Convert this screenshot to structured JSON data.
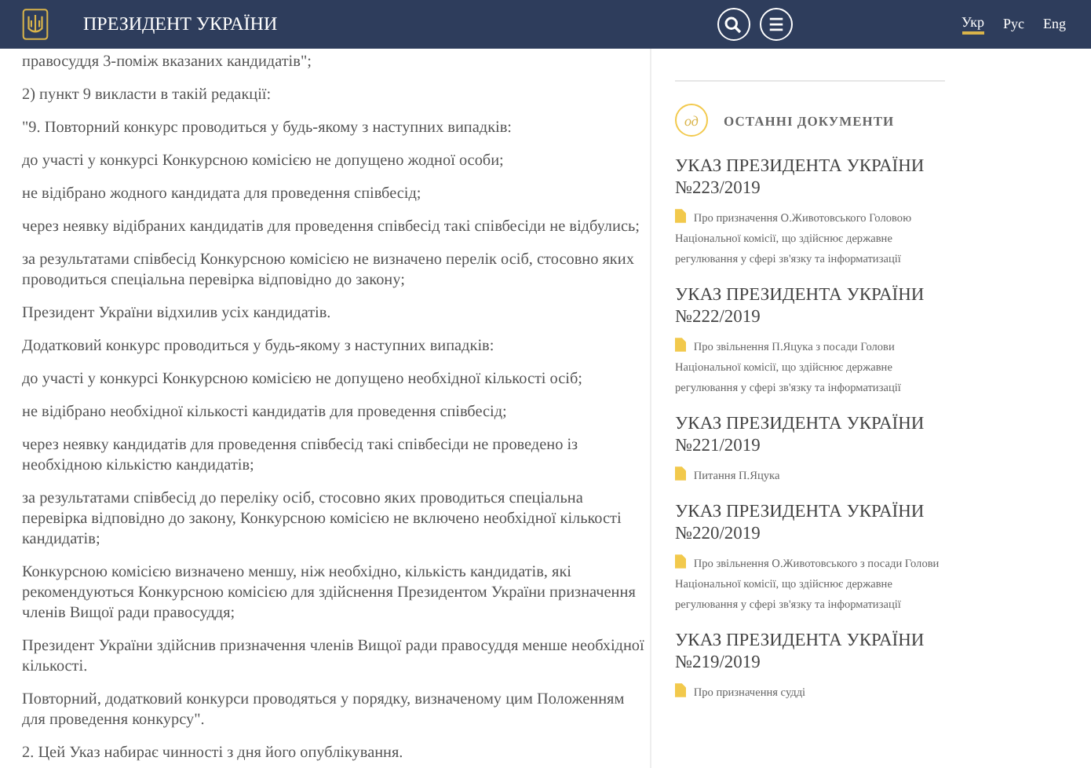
{
  "header": {
    "title": "ПРЕЗИДЕНТ УКРАЇНИ",
    "languages": [
      {
        "label": "Укр",
        "selected": true
      },
      {
        "label": "Рус",
        "selected": false
      },
      {
        "label": "Eng",
        "selected": false
      }
    ]
  },
  "article": {
    "paragraphs": [
      "правосуддя 3-поміж вказаних кандидатів\";",
      "2) пункт 9 викласти в такій редакції:",
      "\"9. Повторний конкурс проводиться у будь-якому з наступних випадків:",
      "до участі у конкурсі Конкурсною комісією не допущено жодної особи;",
      "не відібрано жодного кандидата для проведення співбесід;",
      "через неявку відібраних кандидатів для проведення співбесід такі співбесіди не відбулись;",
      "за результатами співбесід Конкурсною комісією не визначено перелік осіб, стосовно яких проводиться спеціальна перевірка відповідно до закону;",
      "Президент України відхилив усіх кандидатів.",
      "Додатковий конкурс проводиться у будь-якому з наступних випадків:",
      "до участі у конкурсі Конкурсною комісією не допущено необхідної кількості осіб;",
      "не відібрано необхідної кількості кандидатів для проведення співбесід;",
      "через неявку кандидатів для проведення співбесід такі співбесіди не проведено із необхідною кількістю кандидатів;",
      "за результатами співбесід до переліку осіб, стосовно яких проводиться спеціальна перевірка відповідно до закону, Конкурсною комісією не включено необхідної кількості кандидатів;",
      "Конкурсною комісією визначено меншу, ніж необхідно, кількість кандидатів, які рекомендуються Конкурсною комісією для здійснення Президентом України призначення членів Вищої ради правосуддя;",
      "Президент України здійснив призначення членів Вищої ради правосуддя менше необхідної кількості.",
      "Повторний, додатковий конкурси проводяться у порядку, визначеному цим Положенням для проведення конкурсу\".",
      "2. Цей Указ набирає чинності з дня його опублікування."
    ]
  },
  "sidebar": {
    "icon_text": "од",
    "heading": "ОСТАННІ ДОКУМЕНТИ",
    "documents": [
      {
        "title": "УКАЗ ПРЕЗИДЕНТА УКРАЇНИ №223/2019",
        "description": "Про призначення О.Животовського Головою Національної комісії, що здійснює державне регулювання у сфері зв'язку та інформатизації"
      },
      {
        "title": "УКАЗ ПРЕЗИДЕНТА УКРАЇНИ №222/2019",
        "description": "Про звільнення П.Яцука з посади Голови Національної комісії, що здійснює державне регулювання у сфері зв'язку та інформатизації"
      },
      {
        "title": "УКАЗ ПРЕЗИДЕНТА УКРАЇНИ №221/2019",
        "description": "Питання П.Яцука"
      },
      {
        "title": "УКАЗ ПРЕЗИДЕНТА УКРАЇНИ №220/2019",
        "description": "Про звільнення О.Животовського з посади Голови Національної комісії, що здійснює державне регулювання у сфері зв'язку та інформатизації"
      },
      {
        "title": "УКАЗ ПРЕЗИДЕНТА УКРАЇНИ №219/2019",
        "description": "Про призначення судді"
      }
    ]
  }
}
